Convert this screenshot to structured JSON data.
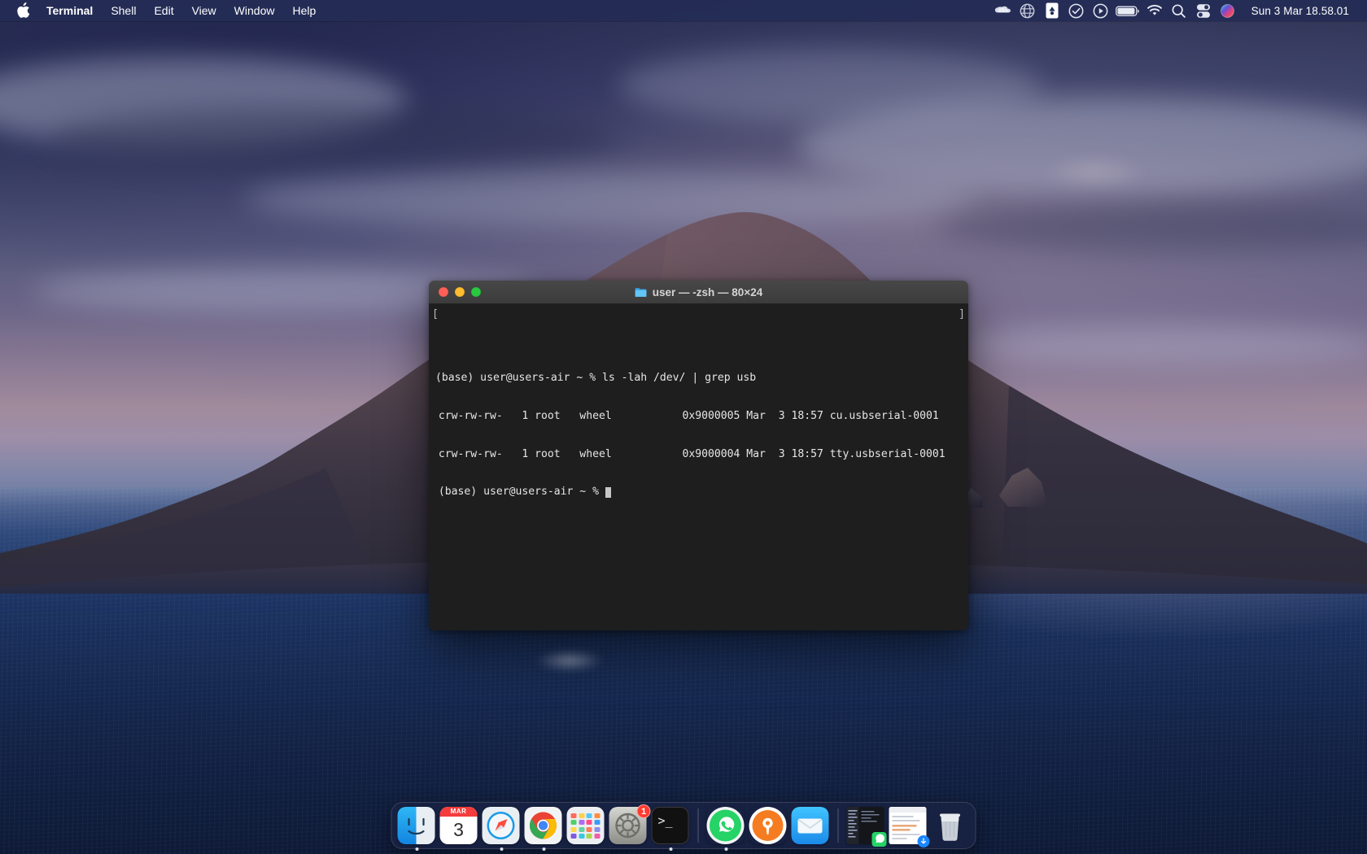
{
  "menubar": {
    "apple_icon": "apple-logo",
    "items": [
      {
        "label": "Terminal",
        "active": true
      },
      {
        "label": "Shell",
        "active": false
      },
      {
        "label": "Edit",
        "active": false
      },
      {
        "label": "View",
        "active": false
      },
      {
        "label": "Window",
        "active": false
      },
      {
        "label": "Help",
        "active": false
      }
    ],
    "status_icons": [
      "onedrive-cloud-icon",
      "globe-icon",
      "dropbox-icon",
      "checkmark-circle-icon",
      "play-circle-icon",
      "battery-icon",
      "wifi-icon",
      "spotlight-search-icon",
      "control-center-icon",
      "siri-icon"
    ],
    "clock": "Sun 3 Mar 18.58.01"
  },
  "terminal": {
    "title": "user — -zsh — 80×24",
    "title_folder_icon": "folder-icon",
    "traffic_lights": {
      "close": "close-button",
      "minimize": "minimize-button",
      "zoom": "zoom-button"
    },
    "background_color": "#1e1e1e",
    "text_color": "#e6e6e6",
    "lines": [
      "(base) user@users-air ~ % ls -lah /dev/ | grep usb",
      " crw-rw-rw-   1 root   wheel           0x9000005 Mar  3 18:57 cu.usbserial-0001",
      " crw-rw-rw-   1 root   wheel           0x9000004 Mar  3 18:57 tty.usbserial-0001",
      " (base) user@users-air ~ % "
    ],
    "left_bracket": "[",
    "right_bracket": "]",
    "prompt": "(base) user@users-air ~ %",
    "command": "ls -lah /dev/ | grep usb",
    "cursor": "block-cursor"
  },
  "dock": {
    "apps": [
      {
        "name": "finder",
        "label": "Finder",
        "running": true
      },
      {
        "name": "calendar",
        "label": "Calendar",
        "running": false,
        "month": "MAR",
        "day": "3"
      },
      {
        "name": "safari",
        "label": "Safari",
        "running": true
      },
      {
        "name": "chrome",
        "label": "Google Chrome",
        "running": true
      },
      {
        "name": "launchpad",
        "label": "Launchpad",
        "running": false
      },
      {
        "name": "system-preferences",
        "label": "System Preferences",
        "running": false,
        "badge": "1"
      },
      {
        "name": "terminal",
        "label": "Terminal",
        "running": true
      },
      {
        "name": "whatsapp",
        "label": "WhatsApp",
        "running": true
      },
      {
        "name": "openvpn",
        "label": "OpenVPN Connect",
        "running": false
      },
      {
        "name": "mail",
        "label": "Mail",
        "running": false
      }
    ],
    "files": [
      {
        "name": "screenshot-file",
        "label": "Screenshot"
      },
      {
        "name": "document-file",
        "label": "Document"
      },
      {
        "name": "trash",
        "label": "Trash"
      }
    ]
  }
}
